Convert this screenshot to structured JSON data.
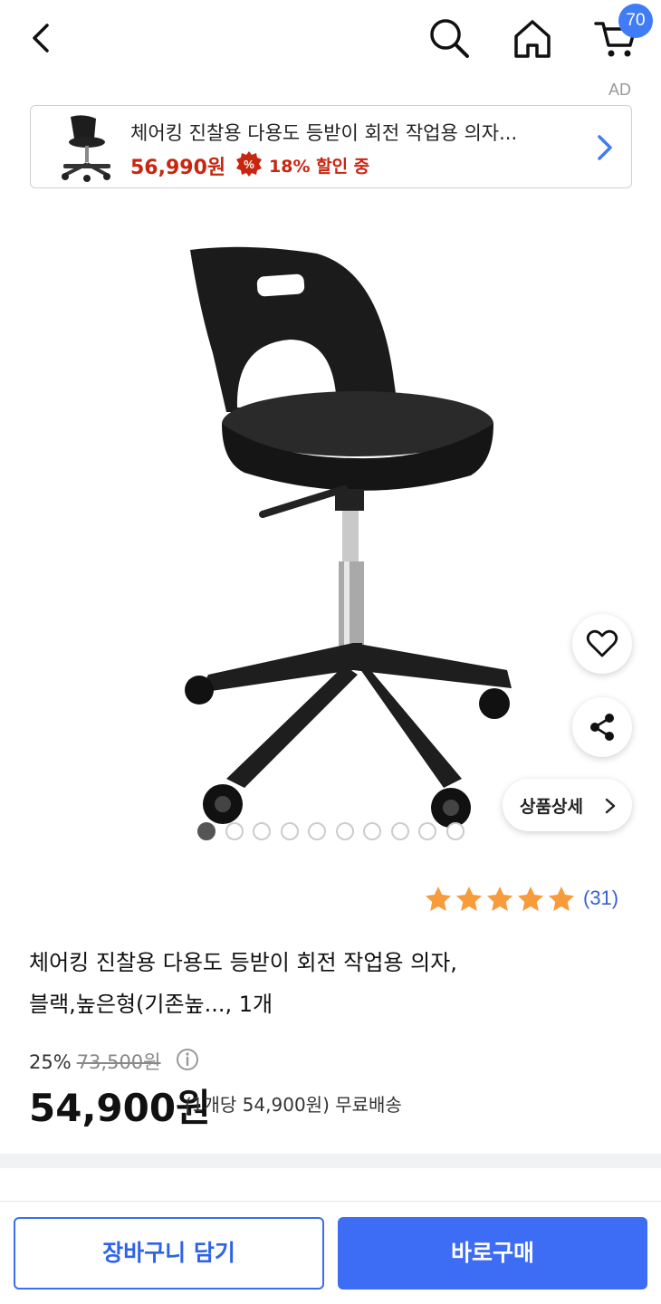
{
  "header": {
    "cart_count": "70",
    "ad_label": "AD",
    "icons": [
      "back-arrow-icon",
      "search-icon",
      "home-icon",
      "cart-icon"
    ]
  },
  "ad_banner": {
    "title": "체어킹 진찰용 다용도 등받이 회전 작업용 의자...",
    "price": "56,990원",
    "discount": "18% 할인 중",
    "accent_color": "#c8260f"
  },
  "gallery": {
    "total_images": 10,
    "active_index": 0,
    "detail_button_label": "상품상세"
  },
  "rating": {
    "stars": 5,
    "count": "(31)"
  },
  "product": {
    "title_line1": "체어킹 진찰용 다용도 등받이 회전 작업용 의자,",
    "title_line2": "블랙,높은형(기존높..., 1개",
    "discount_rate": "25%",
    "original_price": "73,500원",
    "price": "54,900원",
    "unit_price": "(1개당 54,900원) 무료배송"
  },
  "actions": {
    "add_to_cart": "장바구니 담기",
    "buy_now": "바로구매",
    "primary_color": "#3d6cf5"
  }
}
